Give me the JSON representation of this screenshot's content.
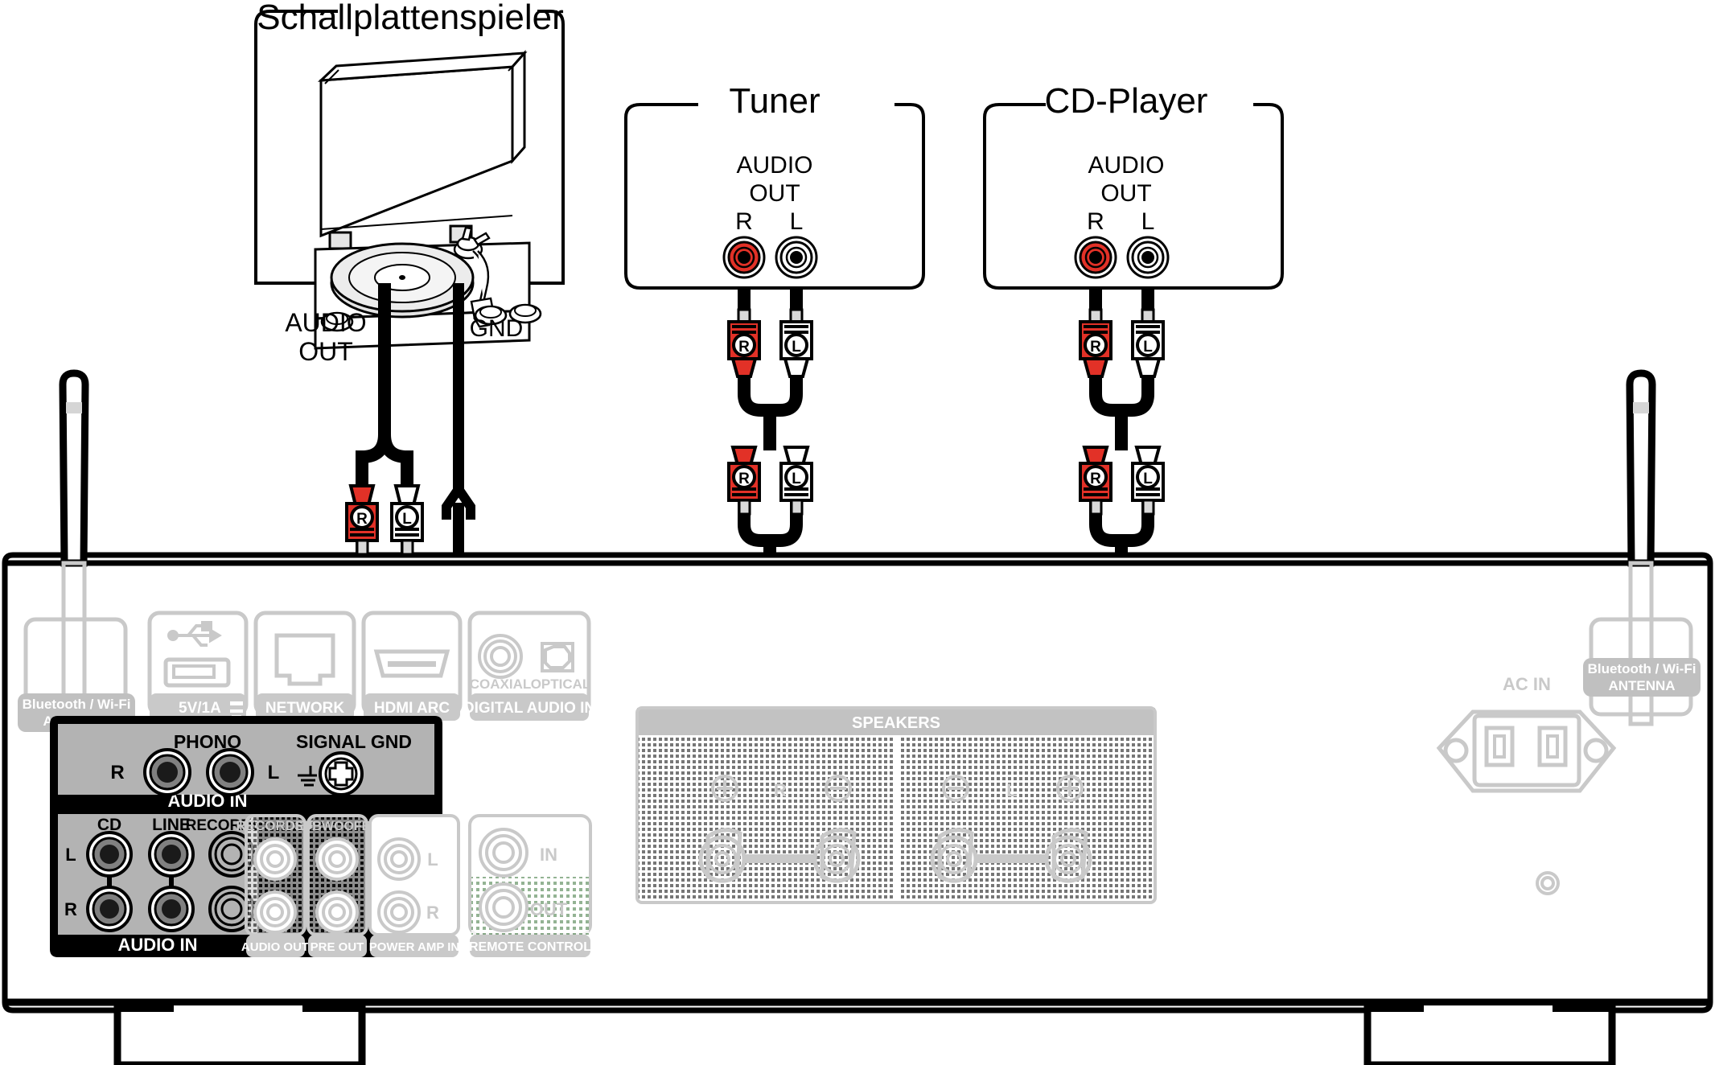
{
  "diagram": {
    "title_turntable": "Schallplattenspieler",
    "title_tuner": "Tuner",
    "title_cdplayer": "CD-Player"
  },
  "sources": {
    "turntable": {
      "name": "Schallplattenspieler",
      "audio_out_line1": "AUDIO",
      "audio_out_line2": "OUT",
      "gnd_label": "GND"
    },
    "tuner": {
      "name": "Tuner",
      "audio_line1": "AUDIO",
      "audio_line2": "OUT",
      "jack_r": "R",
      "jack_l": "L"
    },
    "cdplayer": {
      "name": "CD-Player",
      "audio_line1": "AUDIO",
      "audio_line2": "OUT",
      "jack_r": "R",
      "jack_l": "L"
    }
  },
  "plugs": {
    "r_label": "R",
    "l_label": "L"
  },
  "amplifier": {
    "antenna_left_label_line1": "Bluetooth / Wi-Fi",
    "antenna_left_label_line2": "ANTENNA",
    "antenna_right_label_line1": "Bluetooth / Wi-Fi",
    "antenna_right_label_line2": "ANTENNA",
    "usb_label": "5V/1A",
    "network_label": "NETWORK",
    "hdmi_label": "HDMI ARC",
    "coaxial_label": "COAXIAL",
    "optical_label": "OPTICAL",
    "digital_audio_in_label": "DIGITAL AUDIO IN",
    "phono_label": "PHONO",
    "phono_r": "R",
    "phono_l": "L",
    "signal_gnd_label": "SIGNAL GND",
    "audio_in_bar_top": "AUDIO IN",
    "audio_in_bar_bottom": "AUDIO IN",
    "analog_columns": [
      "CD",
      "LINE",
      "RECORDER"
    ],
    "analog_rows": [
      "L",
      "R"
    ],
    "out_recorder_label": "RECORDER",
    "out_subwoofer_label": "SUBWOOFER",
    "audio_out_label": "AUDIO OUT",
    "pre_out_label": "PRE OUT",
    "power_amp_in_label": "POWER AMP IN",
    "power_amp_l": "L",
    "power_amp_r": "R",
    "remote_control_label": "REMOTE CONTROL",
    "remote_in": "IN",
    "remote_out": "OUT",
    "speakers_label": "SPEAKERS",
    "speaker_r": "R",
    "speaker_l": "L",
    "ac_in_label": "AC IN"
  },
  "colors": {
    "red": "#e23127",
    "black": "#000000",
    "panel_grey": "#b3b3b3",
    "faint_grey": "#c9c9c9",
    "mid_grey": "#808080",
    "white": "#ffffff"
  }
}
